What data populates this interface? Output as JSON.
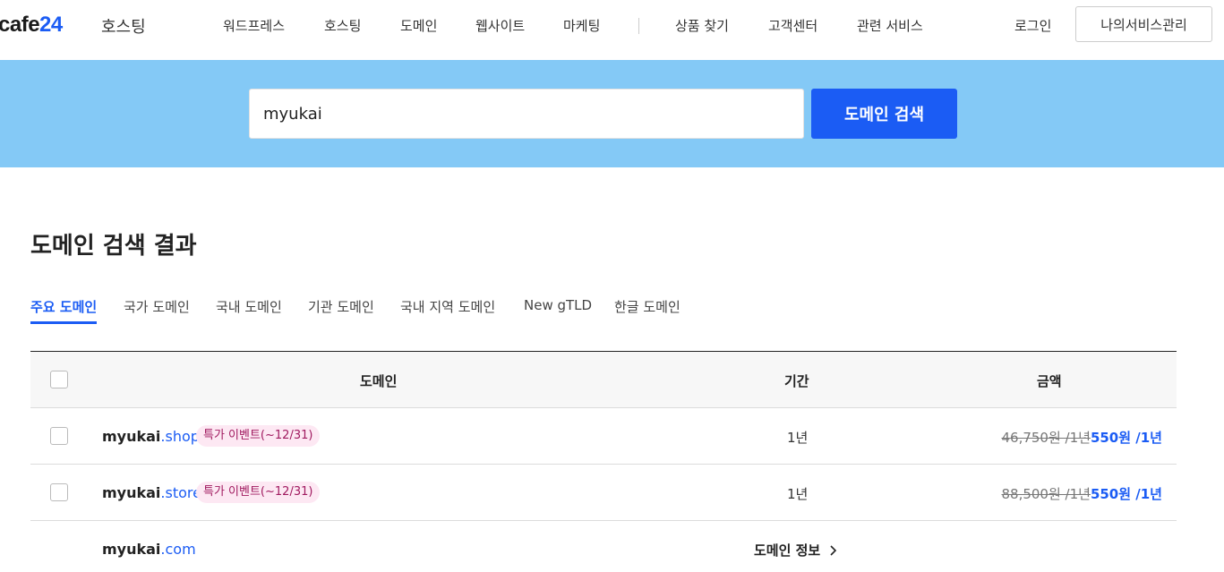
{
  "header": {
    "logo_main": "cafe",
    "logo_num": "24",
    "logo_sub": "호스팅",
    "nav": [
      "워드프레스",
      "호스팅",
      "도메인",
      "웹사이트",
      "마케팅",
      "상품 찾기",
      "고객센터",
      "관련 서비스"
    ],
    "login_label": "로그인",
    "my_service_label": "나의서비스관리"
  },
  "search": {
    "value": "myukai",
    "button_label": "도메인 검색"
  },
  "results": {
    "title": "도메인 검색 결과",
    "tabs": [
      "주요 도메인",
      "국가 도메인",
      "국내 도메인",
      "기관 도메인",
      "국내 지역 도메인",
      "New gTLD",
      "한글 도메인"
    ],
    "active_tab": "주요 도메인",
    "columns": [
      "도메인",
      "기간",
      "금액"
    ],
    "rows": [
      {
        "base": "myukai",
        "tld": ".shop",
        "badge": "특가 이벤트(~12/31)",
        "period": "1년",
        "old_price": "46,750원 /1년",
        "new_price": "550원 /1년"
      },
      {
        "base": "myukai",
        "tld": ".store",
        "badge": "특가 이벤트(~12/31)",
        "period": "1년",
        "old_price": "88,500원 /1년",
        "new_price": "550원 /1년"
      },
      {
        "base": "myukai",
        "tld": ".com",
        "info_label": "도메인 정보",
        "info_icon": "chevron-right-icon"
      }
    ]
  },
  "colors": {
    "accent": "#1b5cf4",
    "band": "#84c9f6",
    "badge_bg": "#fde8f3",
    "badge_text": "#a0195f"
  }
}
